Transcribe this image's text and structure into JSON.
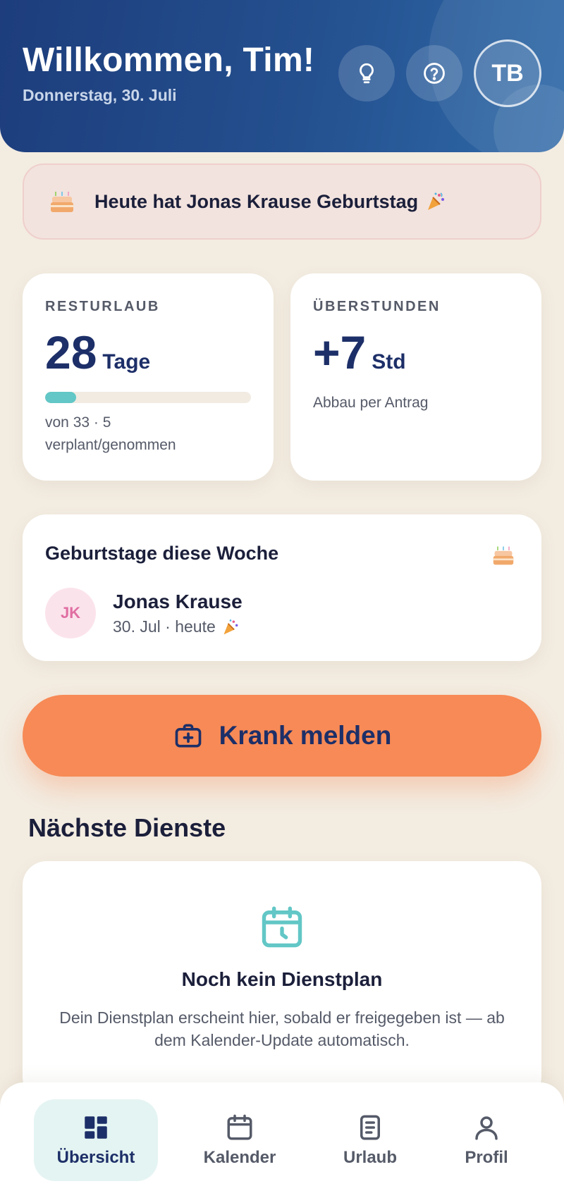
{
  "header": {
    "welcome": "Willkommen, Tim!",
    "date": "Donnerstag, 30. Juli",
    "tip_icon": "lightbulb-icon",
    "help_icon": "question-circle-icon",
    "avatar_initials": "TB"
  },
  "birthday_banner": {
    "text": "Heute hat Jonas Krause Geburtstag",
    "cake_icon": "cake-icon",
    "party_icon": "party-popper-icon"
  },
  "vacation": {
    "label": "RESTURLAUB",
    "value": "28",
    "unit": "Tage",
    "sub": "von 33 · 5 verplant/genommen",
    "progress_fraction": 0.15,
    "color": "#62c7c6"
  },
  "overtime": {
    "label": "ÜBERSTUNDEN",
    "value": "+7",
    "unit": "Std",
    "sub": "Abbau per Antrag"
  },
  "birthdays": {
    "title": "Geburtstage diese Woche",
    "items": [
      {
        "initials": "JK",
        "name": "Jonas Krause",
        "date": "30. Jul · heute"
      }
    ]
  },
  "sick_button": {
    "label": "Krank melden",
    "icon": "medical-kit-icon",
    "color": "#f78a56"
  },
  "shifts": {
    "title": "Nächste Dienste",
    "empty_title": "Noch kein Dienstplan",
    "empty_text": "Dein Dienstplan erscheint hier, sobald er freigegeben ist — ab dem Kalender-Update automatisch."
  },
  "nav": {
    "items": [
      {
        "label": "Übersicht",
        "icon": "dashboard-icon",
        "active": true
      },
      {
        "label": "Kalender",
        "icon": "calendar-icon",
        "active": false
      },
      {
        "label": "Urlaub",
        "icon": "document-icon",
        "active": false
      },
      {
        "label": "Profil",
        "icon": "user-icon",
        "active": false
      }
    ]
  },
  "colors": {
    "background": "#f3ece1",
    "header": "#24508f",
    "accent": "#62c7c6",
    "primary_text": "#1d2f68"
  }
}
